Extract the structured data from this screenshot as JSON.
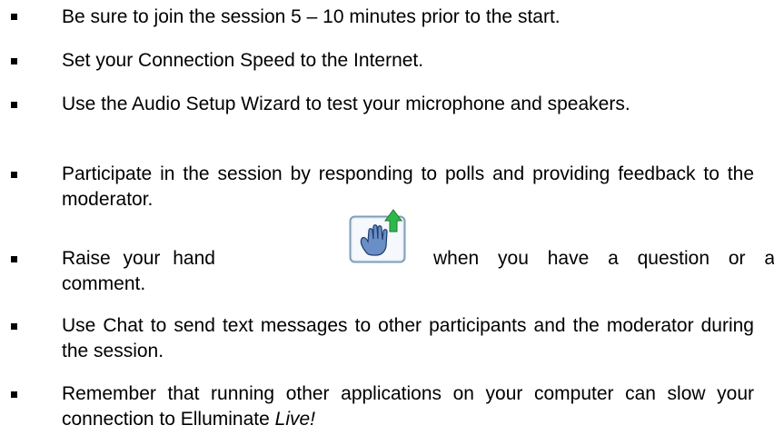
{
  "items": [
    {
      "text": "Be sure to join the session 5 – 10 minutes prior to the start."
    },
    {
      "text": "Set your Connection Speed to the Internet."
    },
    {
      "text": "Use the Audio Setup Wizard to test your microphone and speakers."
    },
    {
      "text": "Participate in the session by responding to polls and providing feedback to the moderator."
    },
    {
      "before": "Raise your hand",
      "after": "when you have a question or a",
      "line2": "comment.",
      "icon": "raise-hand-icon"
    },
    {
      "text": "Use Chat to send text messages to other participants and the moderator during the session."
    },
    {
      "text_main": "Remember that running other applications on your computer can slow your connection to Elluminate ",
      "text_em": "Live!"
    }
  ],
  "colors": {
    "icon_border": "#7f9db9",
    "icon_bg": "#e8eef6",
    "hand_fill": "#6a8fc7",
    "arrow_green": "#2fb84a"
  }
}
